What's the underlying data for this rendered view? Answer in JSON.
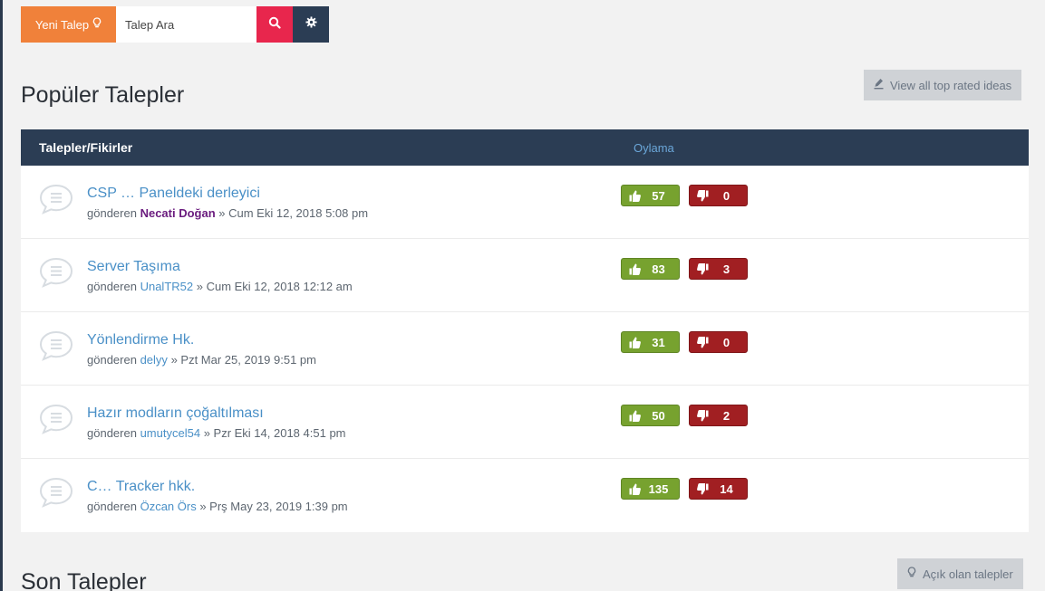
{
  "toolbar": {
    "new_label": "Yeni Talep",
    "search_placeholder": "Talep Ara"
  },
  "popular": {
    "title": "Popüler Talepler",
    "view_all_label": "View all top rated ideas",
    "col_ideas": "Talepler/Fikirler",
    "col_vote": "Oylama",
    "sent_by": "gönderen",
    "rows": [
      {
        "title": "CSP … Paneldeki derleyici",
        "author": "Necati Doğan",
        "date": "» Cum Eki 12, 2018 5:08 pm",
        "up": "57",
        "down": "0"
      },
      {
        "title": "Server Taşıma",
        "author": "UnalTR52",
        "date": "» Cum Eki 12, 2018 12:12 am",
        "up": "83",
        "down": "3"
      },
      {
        "title": "Yönlendirme Hk.",
        "author": "delyy",
        "date": "» Pzt Mar 25, 2019 9:51 pm",
        "up": "31",
        "down": "0"
      },
      {
        "title": "Hazır modların çoğaltılması",
        "author": "umutycel54",
        "date": "» Pzr Eki 14, 2018 4:51 pm",
        "up": "50",
        "down": "2"
      },
      {
        "title": "C… Tracker hkk.",
        "author": "Özcan Örs",
        "date": "» Prş May 23, 2019 1:39 pm",
        "up": "135",
        "down": "14"
      }
    ]
  },
  "recent": {
    "title": "Son Talepler",
    "open_label": "Açık olan talepler"
  },
  "colors": {
    "accent_orange": "#f0813a",
    "search_red": "#e8264d",
    "navy": "#2b3d54",
    "vote_up": "#77a22f",
    "vote_down": "#a11f22",
    "link_blue": "#4a90c7"
  }
}
